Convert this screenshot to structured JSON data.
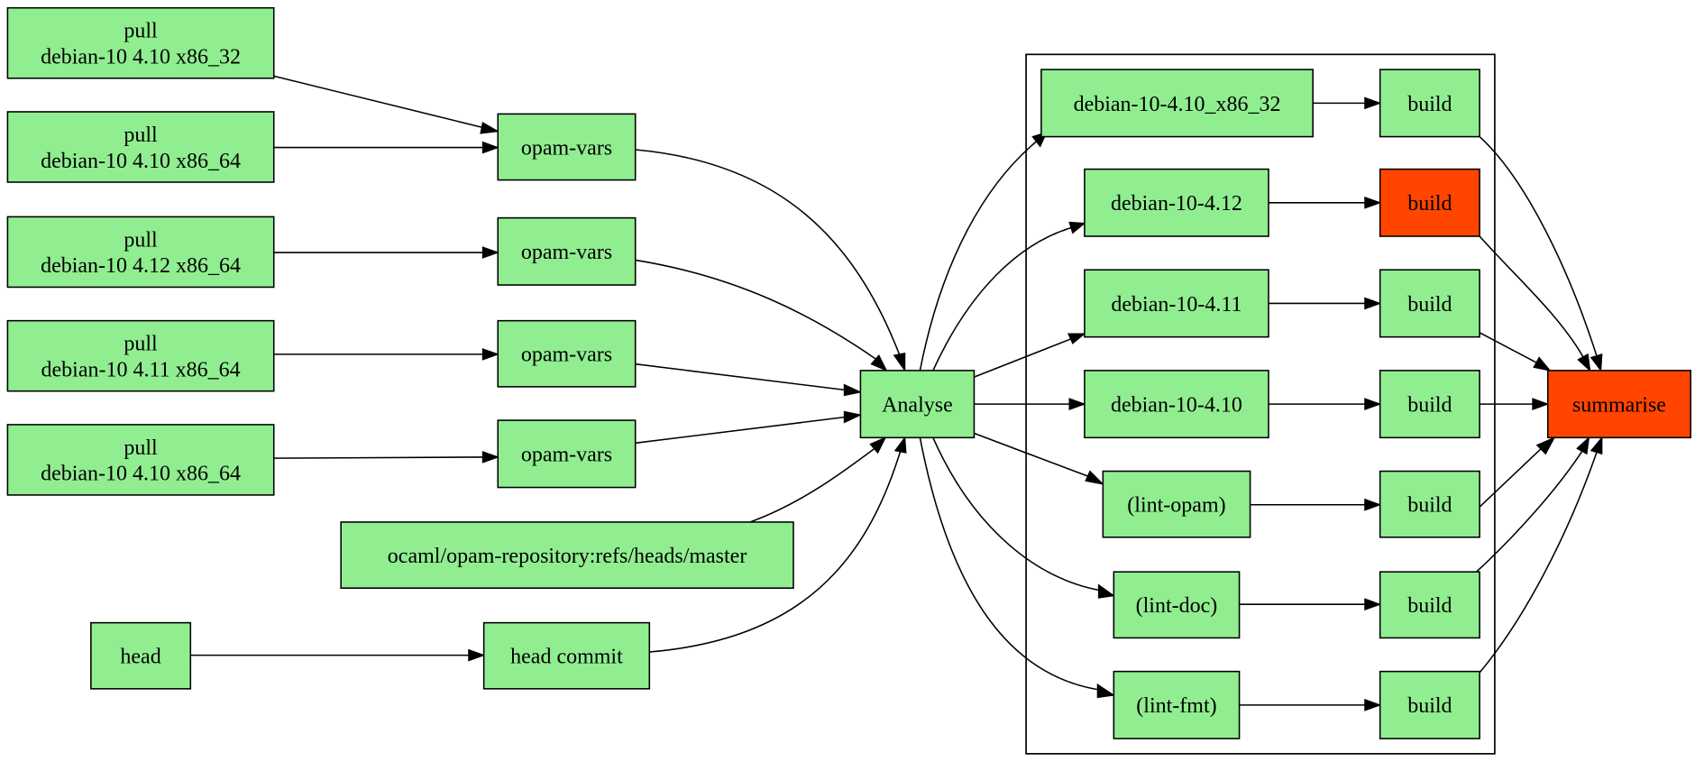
{
  "graph": {
    "colors": {
      "ok": "#90ee90",
      "failed": "#ff4500",
      "stroke": "#000000"
    },
    "nodes": [
      {
        "id": "pull1",
        "lines": [
          "pull",
          "debian-10 4.10 x86_32"
        ],
        "status": "ok"
      },
      {
        "id": "pull2",
        "lines": [
          "pull",
          "debian-10 4.10 x86_64"
        ],
        "status": "ok"
      },
      {
        "id": "pull3",
        "lines": [
          "pull",
          "debian-10 4.12 x86_64"
        ],
        "status": "ok"
      },
      {
        "id": "pull4",
        "lines": [
          "pull",
          "debian-10 4.11 x86_64"
        ],
        "status": "ok"
      },
      {
        "id": "pull5",
        "lines": [
          "pull",
          "debian-10 4.10 x86_64"
        ],
        "status": "ok"
      },
      {
        "id": "vars1",
        "lines": [
          "opam-vars"
        ],
        "status": "ok"
      },
      {
        "id": "vars2",
        "lines": [
          "opam-vars"
        ],
        "status": "ok"
      },
      {
        "id": "vars3",
        "lines": [
          "opam-vars"
        ],
        "status": "ok"
      },
      {
        "id": "vars4",
        "lines": [
          "opam-vars"
        ],
        "status": "ok"
      },
      {
        "id": "repo",
        "lines": [
          "ocaml/opam-repository:refs/heads/master"
        ],
        "status": "ok"
      },
      {
        "id": "head",
        "lines": [
          "head"
        ],
        "status": "ok"
      },
      {
        "id": "headcommit",
        "lines": [
          "head commit"
        ],
        "status": "ok"
      },
      {
        "id": "analyse",
        "lines": [
          "Analyse"
        ],
        "status": "ok"
      },
      {
        "id": "v32",
        "lines": [
          "debian-10-4.10_x86_32"
        ],
        "status": "ok"
      },
      {
        "id": "v412",
        "lines": [
          "debian-10-4.12"
        ],
        "status": "ok"
      },
      {
        "id": "v411",
        "lines": [
          "debian-10-4.11"
        ],
        "status": "ok"
      },
      {
        "id": "v410",
        "lines": [
          "debian-10-4.10"
        ],
        "status": "ok"
      },
      {
        "id": "lintopam",
        "lines": [
          "(lint-opam)"
        ],
        "status": "ok"
      },
      {
        "id": "lintdoc",
        "lines": [
          "(lint-doc)"
        ],
        "status": "ok"
      },
      {
        "id": "lintfmt",
        "lines": [
          "(lint-fmt)"
        ],
        "status": "ok"
      },
      {
        "id": "b1",
        "lines": [
          "build"
        ],
        "status": "ok"
      },
      {
        "id": "b2",
        "lines": [
          "build"
        ],
        "status": "failed"
      },
      {
        "id": "b3",
        "lines": [
          "build"
        ],
        "status": "ok"
      },
      {
        "id": "b4",
        "lines": [
          "build"
        ],
        "status": "ok"
      },
      {
        "id": "b5",
        "lines": [
          "build"
        ],
        "status": "ok"
      },
      {
        "id": "b6",
        "lines": [
          "build"
        ],
        "status": "ok"
      },
      {
        "id": "b7",
        "lines": [
          "build"
        ],
        "status": "ok"
      },
      {
        "id": "summarise",
        "lines": [
          "summarise"
        ],
        "status": "failed"
      }
    ],
    "edges": [
      [
        "pull1",
        "vars1"
      ],
      [
        "pull2",
        "vars1"
      ],
      [
        "pull3",
        "vars2"
      ],
      [
        "pull4",
        "vars3"
      ],
      [
        "pull5",
        "vars4"
      ],
      [
        "vars1",
        "analyse"
      ],
      [
        "vars2",
        "analyse"
      ],
      [
        "vars3",
        "analyse"
      ],
      [
        "vars4",
        "analyse"
      ],
      [
        "repo",
        "analyse"
      ],
      [
        "head",
        "headcommit"
      ],
      [
        "headcommit",
        "analyse"
      ],
      [
        "analyse",
        "v32"
      ],
      [
        "analyse",
        "v412"
      ],
      [
        "analyse",
        "v411"
      ],
      [
        "analyse",
        "v410"
      ],
      [
        "analyse",
        "lintopam"
      ],
      [
        "analyse",
        "lintdoc"
      ],
      [
        "analyse",
        "lintfmt"
      ],
      [
        "v32",
        "b1"
      ],
      [
        "v412",
        "b2"
      ],
      [
        "v411",
        "b3"
      ],
      [
        "v410",
        "b4"
      ],
      [
        "lintopam",
        "b5"
      ],
      [
        "lintdoc",
        "b6"
      ],
      [
        "lintfmt",
        "b7"
      ],
      [
        "b1",
        "summarise"
      ],
      [
        "b2",
        "summarise"
      ],
      [
        "b3",
        "summarise"
      ],
      [
        "b4",
        "summarise"
      ],
      [
        "b5",
        "summarise"
      ],
      [
        "b6",
        "summarise"
      ],
      [
        "b7",
        "summarise"
      ]
    ]
  }
}
